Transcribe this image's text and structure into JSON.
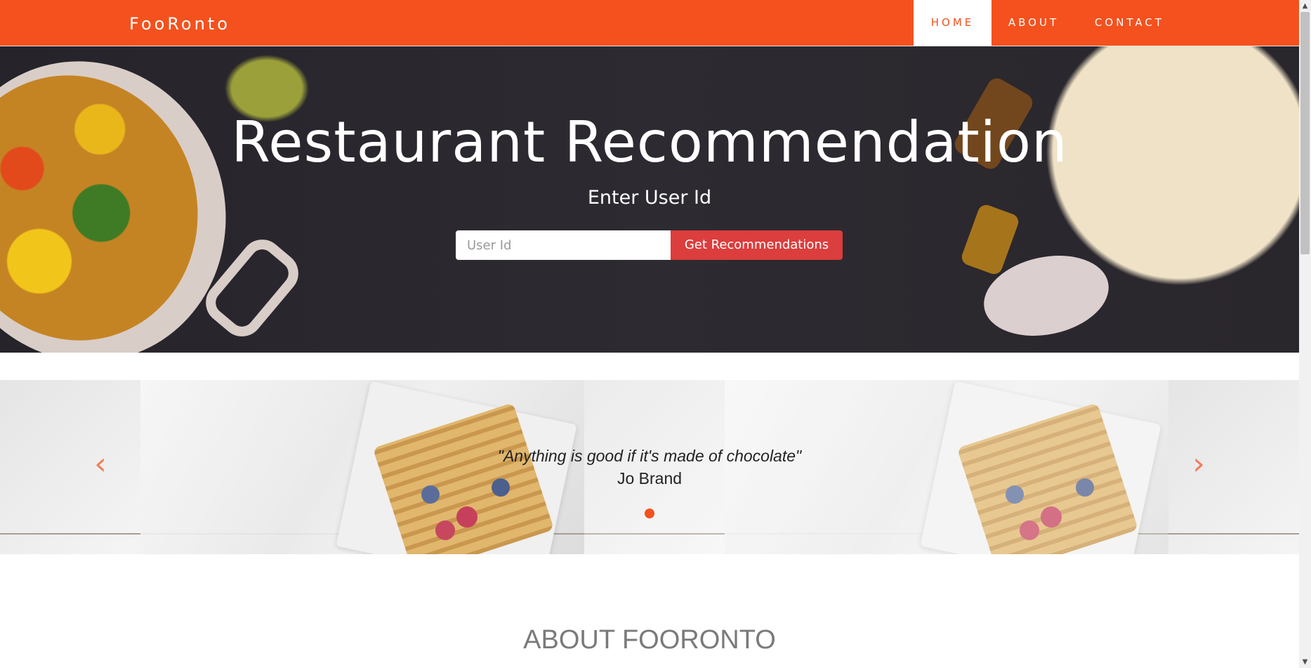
{
  "navbar": {
    "brand": "FooRonto",
    "items": [
      {
        "label": "HOME",
        "active": true
      },
      {
        "label": "ABOUT",
        "active": false
      },
      {
        "label": "CONTACT",
        "active": false
      }
    ],
    "accent_color": "#f4511e"
  },
  "hero": {
    "title": "Restaurant Recommendation",
    "subtitle": "Enter User Id",
    "input_placeholder": "User Id",
    "button_label": "Get Recommendations",
    "button_color": "#dc3d3d"
  },
  "carousel": {
    "quote": "\"Anything is good if it's made of chocolate\"",
    "author": "Jo Brand",
    "prev_icon": "chevron-left-icon",
    "next_icon": "chevron-right-icon",
    "prev_glyph": "‹",
    "next_glyph": "›"
  },
  "about": {
    "title": "ABOUT FOORONTO"
  },
  "scrollbar": {
    "up_glyph": "▲",
    "down_glyph": "▼"
  }
}
